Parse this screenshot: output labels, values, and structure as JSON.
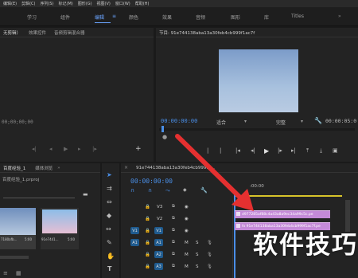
{
  "menu": [
    "编辑(E)",
    "剪辑(C)",
    "序列(S)",
    "标记(M)",
    "图形(G)",
    "视图(V)",
    "窗口(W)",
    "帮助(H)"
  ],
  "workspaces": [
    "学习",
    "组件",
    "编辑",
    "颜色",
    "效果",
    "音频",
    "图形",
    "库",
    "Titles"
  ],
  "source_panel": {
    "tabs": [
      "无剪辑）",
      "效果控件",
      "音频剪辑混合器"
    ],
    "timecode": "00;00;00;00"
  },
  "program": {
    "title": "节目: 91e744138aba13a30feb4cb999f1ac7f",
    "timecode": "00:00:00:00",
    "fit": "适合",
    "quality": "完整",
    "end_timecode": "00:00:05:0"
  },
  "project": {
    "tabs": [
      "百度经验_1",
      "媒体浏览"
    ],
    "file": "百度经验_1.prproj",
    "items": [
      {
        "name": "7180afb...",
        "duration": "5:00"
      },
      {
        "name": "91e7441...",
        "duration": "5:00"
      }
    ]
  },
  "timeline": {
    "tab": "91e744138aba13a30feb4cb999f1...",
    "timecode": "00:00:00:00",
    "ruler_end": ":00:00",
    "tracks": [
      {
        "id": "V3"
      },
      {
        "id": "V2",
        "clip": "d977285af88c4a43a8a9ec34a99c5c.pe"
      },
      {
        "id": "V1",
        "source": "V1",
        "clip": "fx  91e744138aba13a30feb4cb999f1ac7f.pe"
      },
      {
        "id": "A1",
        "source": "A1",
        "m": "M",
        "s": "S"
      },
      {
        "id": "A2",
        "m": "M",
        "s": "S"
      },
      {
        "id": "A3",
        "m": "M",
        "s": "S"
      }
    ]
  },
  "watermark": "软件技巧",
  "colors": {
    "accent": "#4a8fe8",
    "clip": "#c48ad8",
    "arrow": "#e53030",
    "track_target": "#1f5b8f"
  }
}
